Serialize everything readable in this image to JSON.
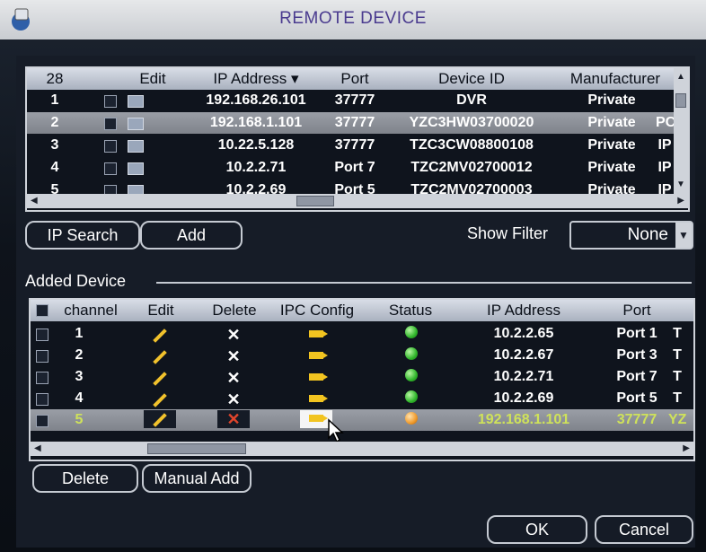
{
  "window": {
    "title": "REMOTE DEVICE"
  },
  "search": {
    "count_label": "28",
    "columns": {
      "edit": "Edit",
      "ip_address": "IP Address",
      "port": "Port",
      "device_id": "Device ID",
      "manufacturer": "Manufacturer"
    },
    "rows": [
      {
        "index": "1",
        "ip": "192.168.26.101",
        "port": "37777",
        "device_id": "DVR",
        "manufacturer": "Private",
        "extra": ""
      },
      {
        "index": "2",
        "ip": "192.168.1.101",
        "port": "37777",
        "device_id": "YZC3HW03700020",
        "manufacturer": "Private",
        "extra": "PC"
      },
      {
        "index": "3",
        "ip": "10.22.5.128",
        "port": "37777",
        "device_id": "TZC3CW08800108",
        "manufacturer": "Private",
        "extra": "IP"
      },
      {
        "index": "4",
        "ip": "10.2.2.71",
        "port": "Port 7",
        "device_id": "TZC2MV02700012",
        "manufacturer": "Private",
        "extra": "IP"
      },
      {
        "index": "5",
        "ip": "10.2.2.69",
        "port": "Port 5",
        "device_id": "TZC2MV02700003",
        "manufacturer": "Private",
        "extra": "IP"
      }
    ],
    "ip_search_label": "IP Search",
    "add_label": "Add",
    "show_filter_label": "Show Filter",
    "filter_value": "None"
  },
  "added": {
    "section_title": "Added Device",
    "columns": {
      "channel": "channel",
      "edit": "Edit",
      "delete": "Delete",
      "ipc_config": "IPC Config",
      "status": "Status",
      "ip_address": "IP Address",
      "port": "Port"
    },
    "rows": [
      {
        "channel": "1",
        "ip": "10.2.2.65",
        "port": "Port 1",
        "extra": "T",
        "status": "online"
      },
      {
        "channel": "2",
        "ip": "10.2.2.67",
        "port": "Port 3",
        "extra": "T",
        "status": "online"
      },
      {
        "channel": "3",
        "ip": "10.2.2.71",
        "port": "Port 7",
        "extra": "T",
        "status": "online"
      },
      {
        "channel": "4",
        "ip": "10.2.2.69",
        "port": "Port 5",
        "extra": "T",
        "status": "online"
      },
      {
        "channel": "5",
        "ip": "192.168.1.101",
        "port": "37777",
        "extra": "YZ",
        "status": "warning"
      }
    ],
    "delete_label": "Delete",
    "manual_add_label": "Manual Add"
  },
  "footer": {
    "ok_label": "OK",
    "cancel_label": "Cancel"
  },
  "colors": {
    "title_text": "#4a3b8f",
    "selected_row": "#8a8e96",
    "status_green": "#2fb52a",
    "status_orange": "#f09a2a"
  }
}
